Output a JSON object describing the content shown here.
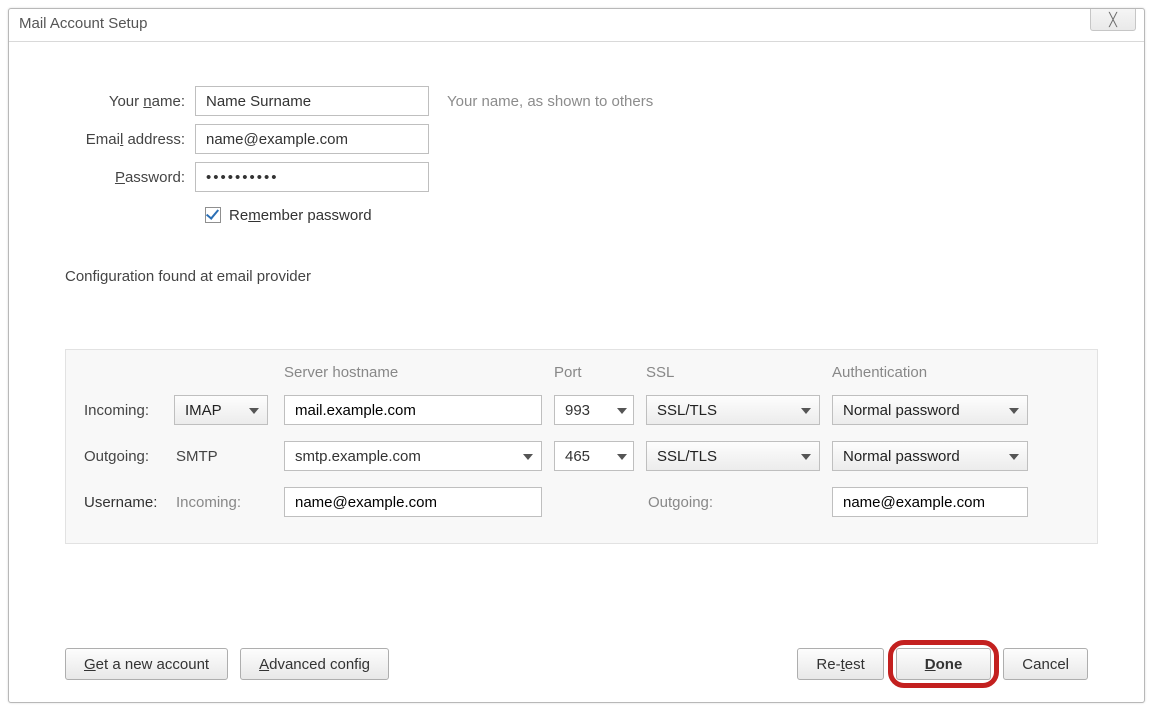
{
  "window": {
    "title": "Mail Account Setup",
    "close_icon": "✕"
  },
  "form": {
    "name_label_pre": "Your ",
    "name_label_u": "n",
    "name_label_post": "ame:",
    "name_value": "Name Surname",
    "name_hint": "Your name, as shown to others",
    "email_label_pre": "Emai",
    "email_label_u": "l",
    "email_label_post": " address:",
    "email_value": "name@example.com",
    "password_label_u": "P",
    "password_label_post": "assword:",
    "password_value": "••••••••••",
    "remember_pre": "Re",
    "remember_u": "m",
    "remember_post": "ember password",
    "remember_checked": true
  },
  "status": "Configuration found at email provider",
  "server": {
    "headers": {
      "hostname": "Server hostname",
      "port": "Port",
      "ssl": "SSL",
      "auth": "Authentication"
    },
    "incoming": {
      "label": "Incoming:",
      "protocol": "IMAP",
      "hostname": "mail.example.com",
      "port": "993",
      "ssl": "SSL/TLS",
      "auth": "Normal password"
    },
    "outgoing": {
      "label": "Outgoing:",
      "protocol": "SMTP",
      "hostname": "smtp.example.com",
      "port": "465",
      "ssl": "SSL/TLS",
      "auth": "Normal password"
    },
    "username": {
      "label": "Username:",
      "incoming_label": "Incoming:",
      "incoming_value": "name@example.com",
      "outgoing_label": "Outgoing:",
      "outgoing_value": "name@example.com"
    }
  },
  "buttons": {
    "get_account_u": "G",
    "get_account_post": "et a new account",
    "advanced_u": "A",
    "advanced_post": "dvanced config",
    "retest_pre": "Re-",
    "retest_u": "t",
    "retest_post": "est",
    "done_u": "D",
    "done_post": "one",
    "cancel": "Cancel"
  }
}
